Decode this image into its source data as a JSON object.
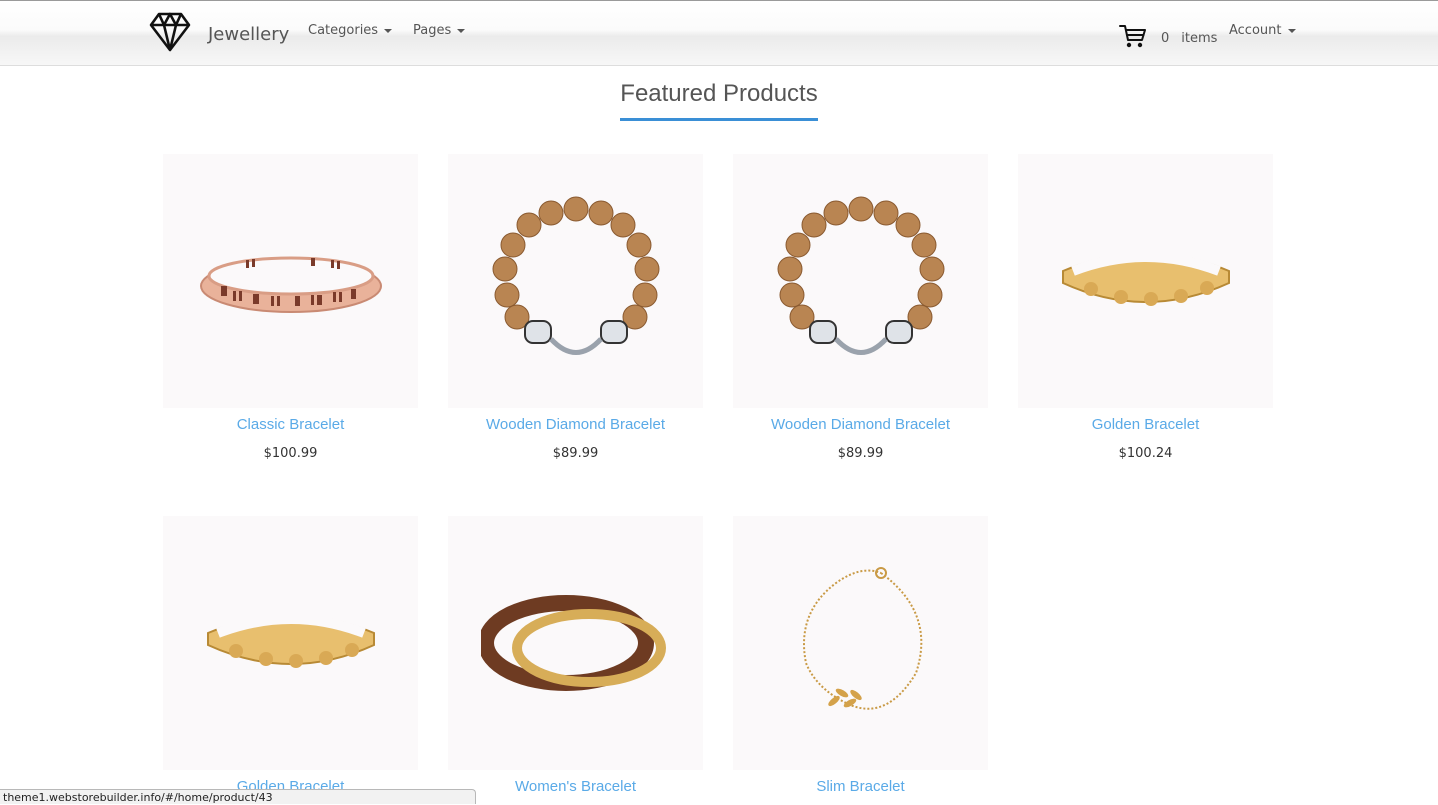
{
  "nav": {
    "brand": "Jewellery",
    "categories": "Categories",
    "pages": "Pages",
    "cart_count": "0",
    "cart_label": "items",
    "account": "Account"
  },
  "section": {
    "title": "Featured Products"
  },
  "products": [
    {
      "name": "Classic Bracelet",
      "price": "$100.99",
      "image": "rose-gold-roman-numeral-bangle"
    },
    {
      "name": "Wooden Diamond Bracelet",
      "price": "$89.99",
      "image": "wooden-bead-bracelet"
    },
    {
      "name": "Wooden Diamond Bracelet",
      "price": "$89.99",
      "image": "wooden-bead-bracelet"
    },
    {
      "name": "Golden Bracelet",
      "price": "$100.24",
      "image": "gold-cuff"
    },
    {
      "name": "Golden Bracelet",
      "price": "",
      "image": "gold-cuff"
    },
    {
      "name": "Women's Bracelet",
      "price": "",
      "image": "wood-gold-double-bangle"
    },
    {
      "name": "Slim Bracelet",
      "price": "",
      "image": "gold-chain-leaf-bracelet"
    }
  ],
  "status_bar": {
    "url": "theme1.webstorebuilder.info/#/home/product/43"
  },
  "colors": {
    "accent": "#3a8fd6",
    "link": "#5aaae7",
    "image_bg": "#fbf9fa"
  }
}
